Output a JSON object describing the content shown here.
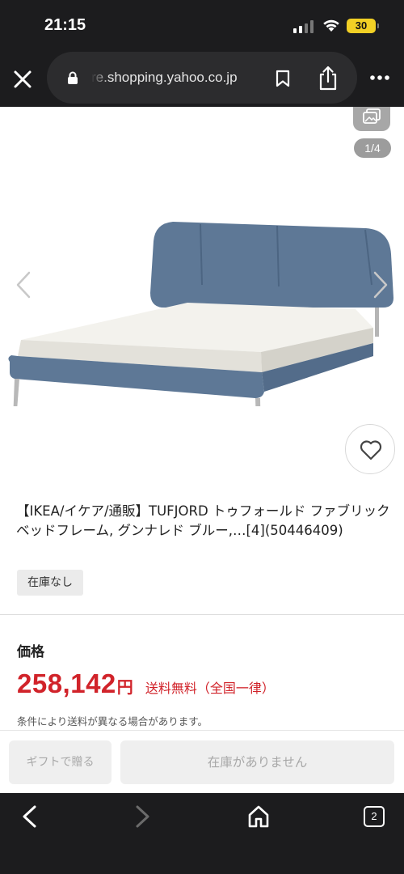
{
  "status_bar": {
    "time": "21:15",
    "battery": "30"
  },
  "browser": {
    "url": "re.shopping.yahoo.co.jp"
  },
  "gallery": {
    "counter": "1/4"
  },
  "product": {
    "title": "【IKEA/イケア/通販】TUFJORD トゥフォールド ファブリックベッドフレーム, グンナレド ブルー,…[4](50446409)",
    "stock_badge": "在庫なし"
  },
  "price": {
    "label": "価格",
    "amount": "258,142",
    "currency": "円",
    "shipping": "送料無料（全国一律）",
    "note": "条件により送料が異なる場合があります。"
  },
  "actions": {
    "gift": "ギフトで贈る",
    "out_of_stock": "在庫がありません"
  },
  "toolbar": {
    "tab_count": "2"
  },
  "colors": {
    "price_red": "#d1232a",
    "bar_dark": "#1c1c1e",
    "bed_fabric": "#5e7896"
  },
  "icons": [
    "close-icon",
    "lock-icon",
    "bookmark-icon",
    "share-icon",
    "more-icon",
    "gallery-icon",
    "chevron-left-icon",
    "chevron-right-icon",
    "heart-icon",
    "back-icon",
    "forward-icon",
    "home-icon",
    "tabs-icon"
  ]
}
